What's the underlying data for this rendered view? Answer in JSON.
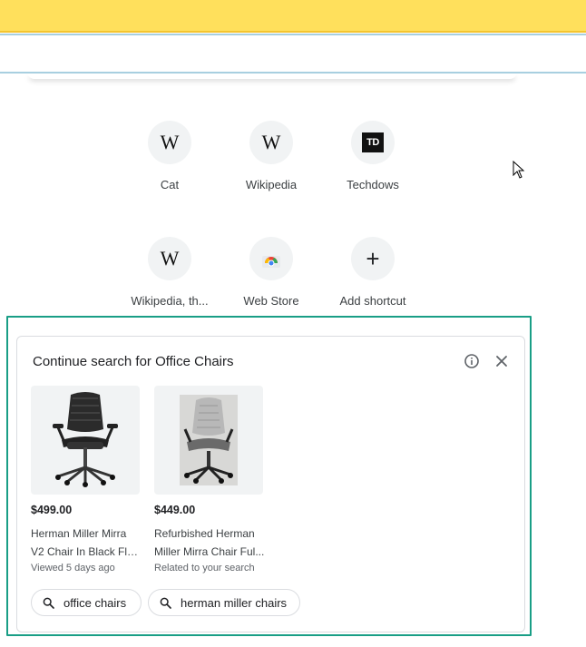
{
  "shortcuts": [
    {
      "label": "Cat",
      "icon": "wikipedia-w-icon",
      "glyph": "W"
    },
    {
      "label": "Wikipedia",
      "icon": "wikipedia-w-icon",
      "glyph": "W"
    },
    {
      "label": "Techdows",
      "icon": "techdows-td-icon",
      "glyph": "TD"
    },
    {
      "label": "Wikipedia, th...",
      "icon": "wikipedia-w-icon",
      "glyph": "W"
    },
    {
      "label": "Web Store",
      "icon": "chrome-web-store-icon"
    },
    {
      "label": "Add shortcut",
      "icon": "plus-icon",
      "glyph": "+"
    }
  ],
  "card": {
    "title": "Continue search for Office Chairs",
    "products": [
      {
        "price": "$499.00",
        "name_line1": "Herman Miller Mirra",
        "name_line2": "V2 Chair In Black Fle...",
        "meta": "Viewed 5 days ago"
      },
      {
        "price": "$449.00",
        "name_line1": "Refurbished Herman",
        "name_line2": "Miller Mirra Chair Ful...",
        "meta": "Related to your search"
      }
    ],
    "chips": [
      {
        "label": "office chairs"
      },
      {
        "label": "herman miller chairs"
      }
    ]
  },
  "colors": {
    "top_band": "#ffe05c",
    "highlight_border": "#199e86",
    "card_border": "#dadce0"
  }
}
